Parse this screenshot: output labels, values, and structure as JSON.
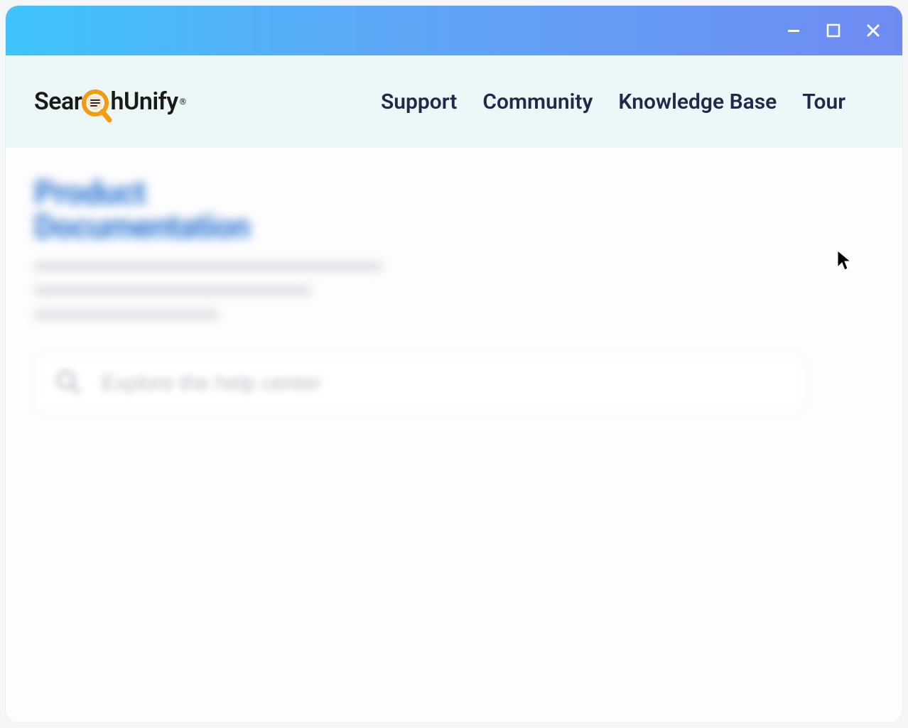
{
  "window": {
    "controls": {
      "minimize_icon": "minimize-icon",
      "maximize_icon": "maximize-icon",
      "close_icon": "close-icon"
    }
  },
  "header": {
    "logo": {
      "text_left": "Sear",
      "text_right": "hUnify",
      "registered_mark": "®"
    },
    "nav": [
      "Support",
      "Community",
      "Knowledge Base",
      "Tour"
    ]
  },
  "hero": {
    "title_line1": "Product",
    "title_line2": "Documentation"
  },
  "search": {
    "placeholder": "Explore the help center"
  }
}
